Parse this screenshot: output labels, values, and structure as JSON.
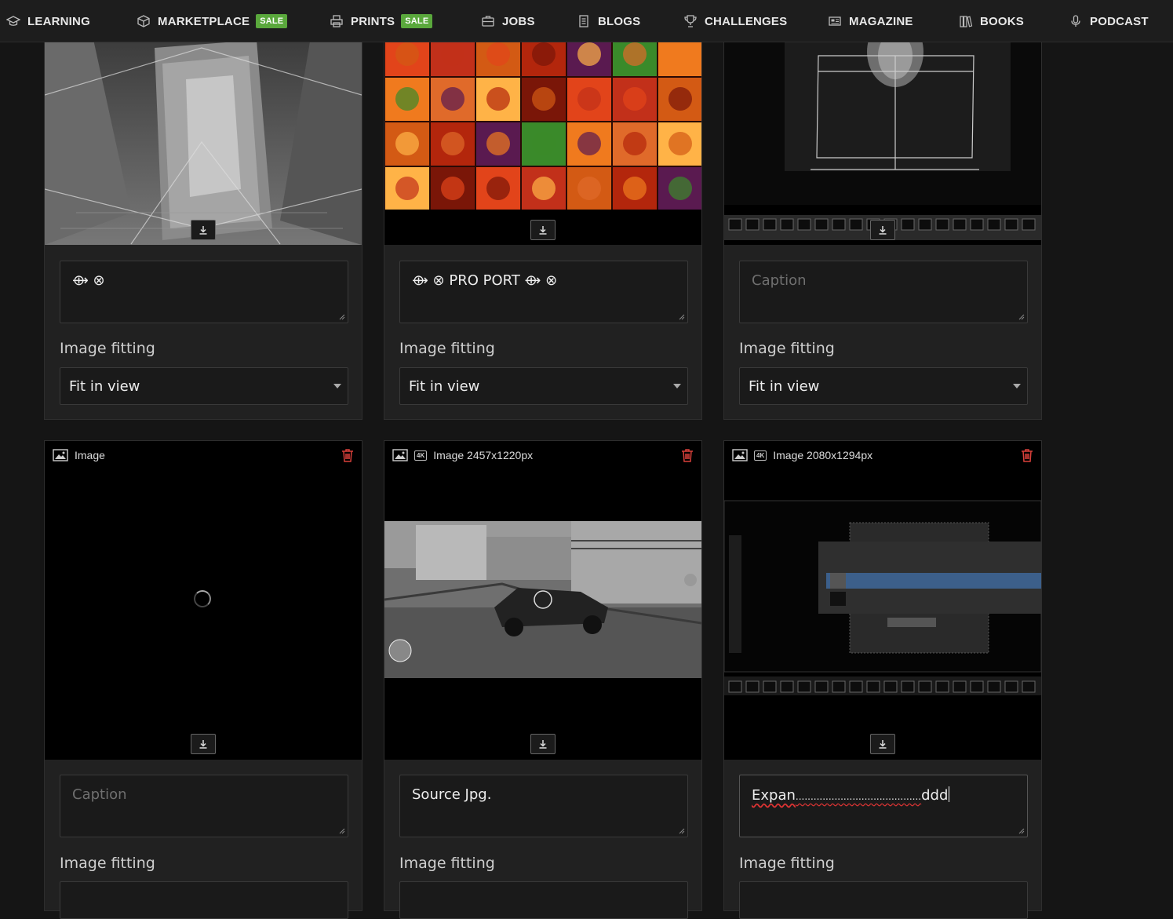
{
  "nav": {
    "items": [
      {
        "label": "LEARNING",
        "icon": "graduation-cap-icon"
      },
      {
        "label": "MARKETPLACE",
        "icon": "box-icon",
        "badge": "SALE"
      },
      {
        "label": "PRINTS",
        "icon": "printer-icon",
        "badge": "SALE"
      },
      {
        "label": "JOBS",
        "icon": "briefcase-icon"
      },
      {
        "label": "BLOGS",
        "icon": "document-icon"
      },
      {
        "label": "CHALLENGES",
        "icon": "trophy-icon"
      },
      {
        "label": "MAGAZINE",
        "icon": "newspaper-icon"
      },
      {
        "label": "BOOKS",
        "icon": "books-icon"
      },
      {
        "label": "PODCAST",
        "icon": "microphone-icon"
      }
    ]
  },
  "cards": [
    {
      "caption_value": "⟴ ⊗",
      "caption_placeholder": "Caption",
      "fitting_label": "Image fitting",
      "fitting_value": "Fit in view",
      "download_icon": "download-icon"
    },
    {
      "caption_value": "⟴ ⊗ PRO PORT ⟴ ⊗",
      "caption_placeholder": "Caption",
      "fitting_label": "Image fitting",
      "fitting_value": "Fit in view",
      "download_icon": "download-icon"
    },
    {
      "caption_value": "",
      "caption_placeholder": "Caption",
      "fitting_label": "Image fitting",
      "fitting_value": "Fit in view",
      "download_icon": "download-icon"
    },
    {
      "header": "Image",
      "caption_value": "",
      "caption_placeholder": "Caption",
      "fitting_label": "Image fitting",
      "loading": true
    },
    {
      "header": "Image 2457x1220px",
      "badge": "4K",
      "caption_value": "Source Jpg.",
      "caption_placeholder": "Caption",
      "fitting_label": "Image fitting"
    },
    {
      "header": "Image 2080x1294px",
      "badge": "4K",
      "caption_value_start": "Expan",
      "caption_value_dots": "..........................................",
      "caption_value_end": "ddd",
      "caption_placeholder": "Caption",
      "fitting_label": "Image fitting"
    }
  ],
  "colors": {
    "background": "#151515",
    "card": "#212121",
    "sale": "#5aa83c",
    "trash": "#d9403a"
  }
}
